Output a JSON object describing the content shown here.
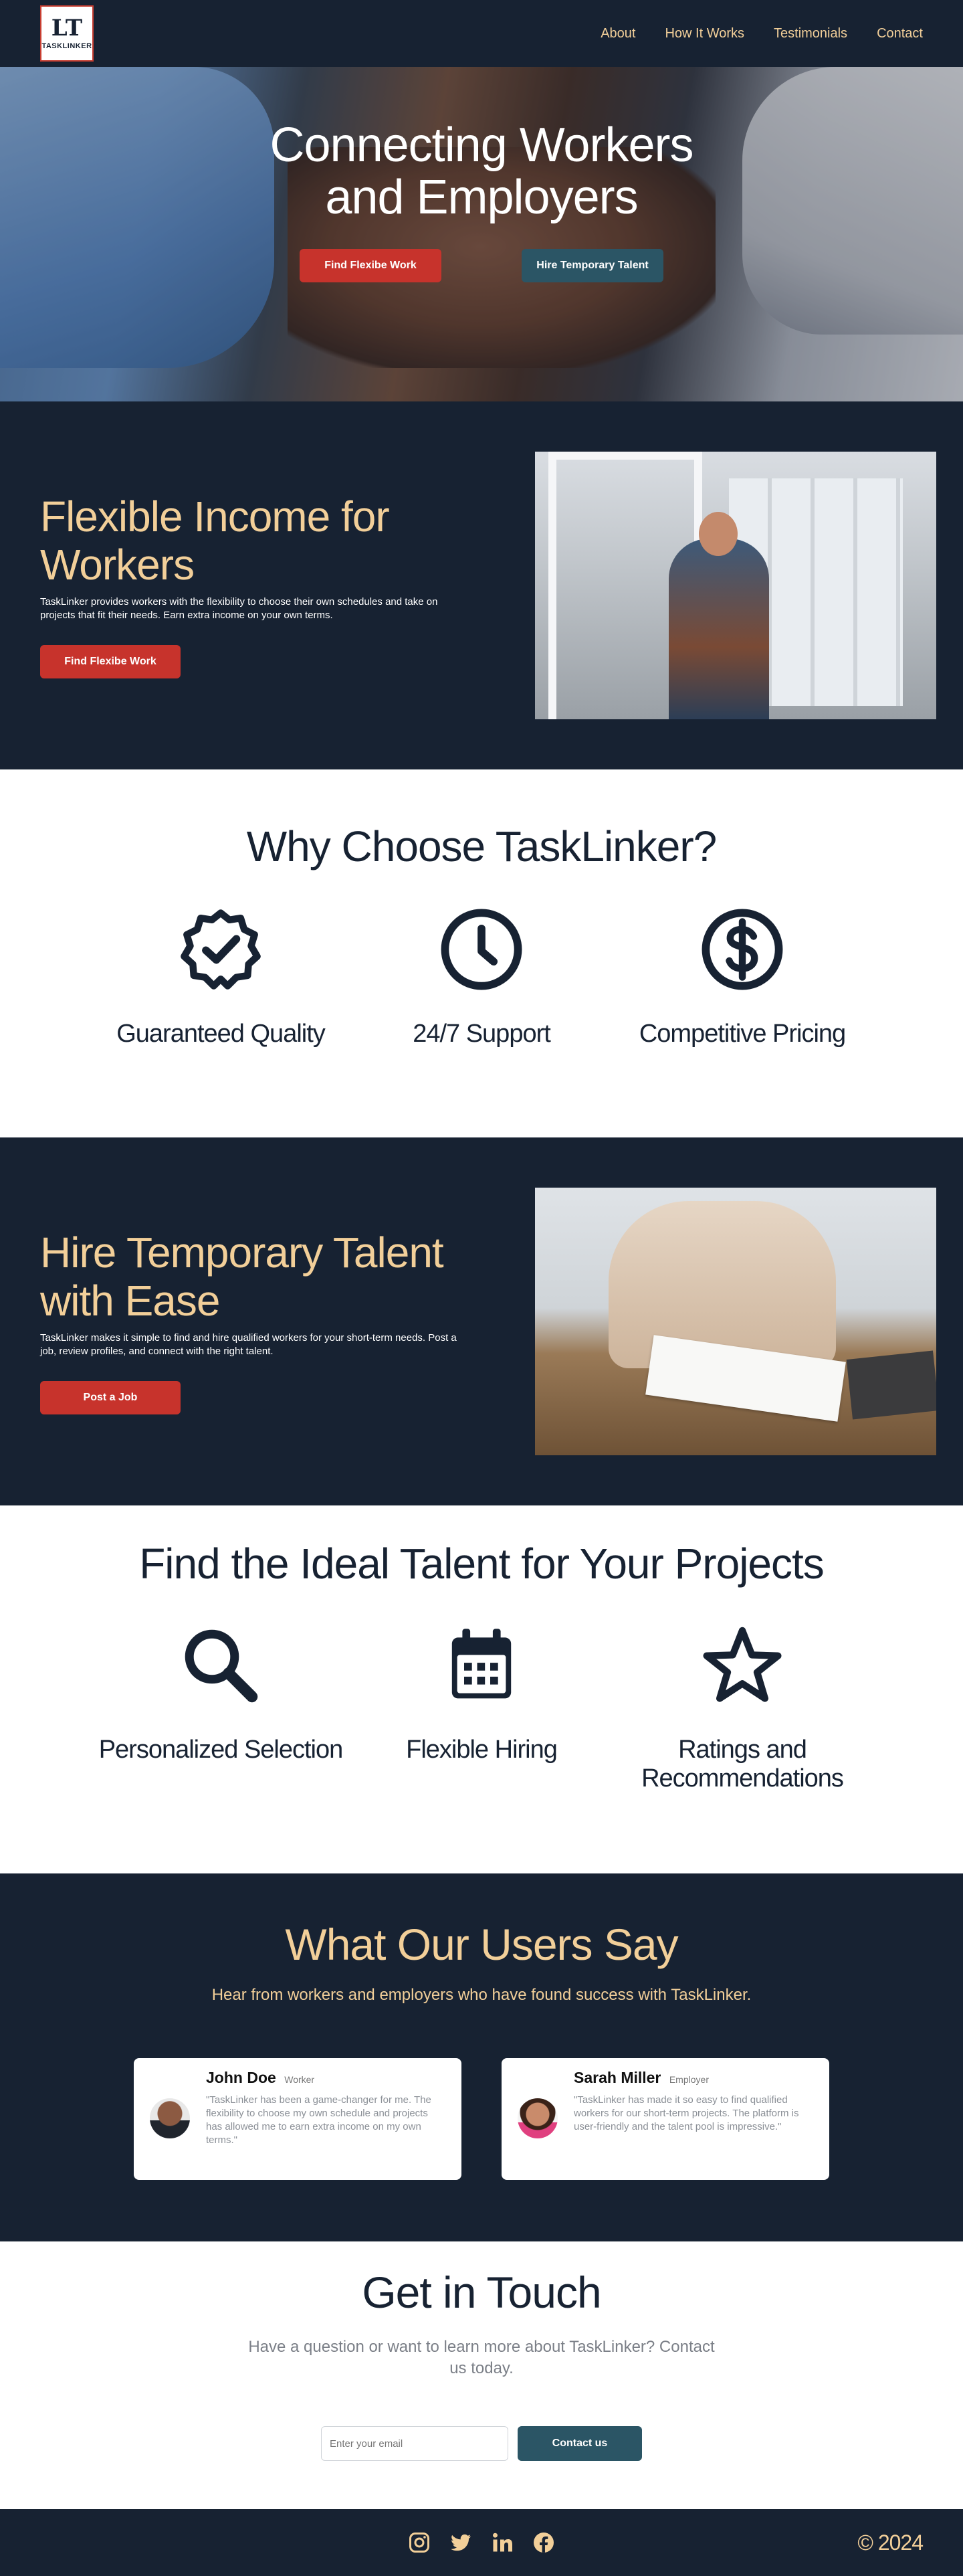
{
  "brand": {
    "logo_mark": "LT",
    "logo_word": "TASKLINKER"
  },
  "nav": {
    "items": [
      "About",
      "How It Works",
      "Testimonials",
      "Contact"
    ]
  },
  "hero": {
    "title": "Connecting Workers and Employers",
    "primary_button": "Find Flexibe Work",
    "secondary_button": "Hire Temporary Talent"
  },
  "workers": {
    "title": "Flexible Income for Workers",
    "text": "TaskLinker provides workers with the flexibility to choose their own schedules and take on projects that fit their needs. Earn extra income on your own terms.",
    "button": "Find Flexibe Work"
  },
  "why": {
    "title": "Why Choose TaskLinker?",
    "features": [
      {
        "label": "Guaranteed Quality",
        "icon": "badge-check-icon"
      },
      {
        "label": "24/7 Support",
        "icon": "clock-icon"
      },
      {
        "label": "Competitive Pricing",
        "icon": "dollar-icon"
      }
    ]
  },
  "hire": {
    "title": "Hire Temporary Talent with Ease",
    "text": "TaskLinker makes it simple to find and hire qualified workers for your short-term needs. Post a job, review profiles, and connect with the right talent.",
    "button": "Post a Job"
  },
  "find": {
    "title": "Find the Ideal Talent for Your Projects",
    "features": [
      {
        "label": "Personalized Selection",
        "icon": "search-icon"
      },
      {
        "label": "Flexible Hiring",
        "icon": "calendar-icon"
      },
      {
        "label": "Ratings and Recommendations",
        "icon": "star-icon"
      }
    ]
  },
  "testimonials": {
    "title": "What Our Users Say",
    "subtitle": "Hear from workers and employers who have found success with TaskLinker.",
    "items": [
      {
        "name": "John Doe",
        "role": "Worker",
        "quote": "\"TaskLinker has been a game-changer for me. The flexibility to choose my own schedule and projects has allowed me to earn extra income on my own terms.\""
      },
      {
        "name": "Sarah Miller",
        "role": "Employer",
        "quote": "\"TaskLinker has made it so easy to find qualified workers for our short-term projects. The platform is user-friendly and the talent pool is impressive.\""
      }
    ]
  },
  "contact": {
    "title": "Get in Touch",
    "subtitle": "Have a question or want to learn more about TaskLinker? Contact us today.",
    "email_placeholder": "Enter your email",
    "button": "Contact us"
  },
  "footer": {
    "socials": [
      "instagram-icon",
      "twitter-icon",
      "linkedin-icon",
      "facebook-icon"
    ],
    "copyright": "© 2024"
  },
  "colors": {
    "navy": "#172232",
    "gold": "#f2cf99",
    "red": "#c7332c",
    "teal": "#2b5565"
  }
}
